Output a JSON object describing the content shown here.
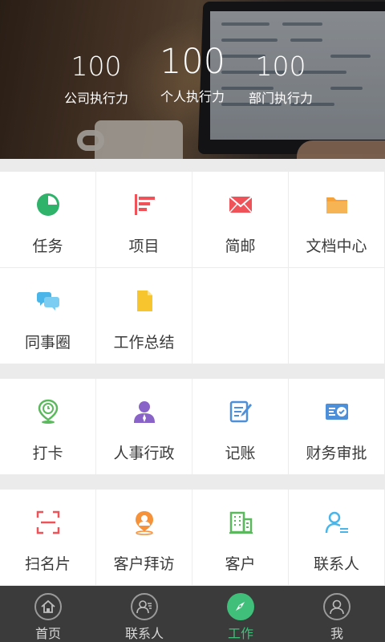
{
  "hero": {
    "stats": [
      {
        "value": "100",
        "label": "公司执行力"
      },
      {
        "value": "100",
        "label": "个人执行力"
      },
      {
        "value": "100",
        "label": "部门执行力"
      }
    ]
  },
  "sections": [
    {
      "items": [
        {
          "label": "任务",
          "icon": "pie-chart-icon",
          "color": "#2fb36b"
        },
        {
          "label": "项目",
          "icon": "project-bars-icon",
          "color": "#f0525a"
        },
        {
          "label": "简邮",
          "icon": "mail-icon",
          "color": "#f0525a"
        },
        {
          "label": "文档中心",
          "icon": "folder-icon",
          "color": "#f5a23a"
        },
        {
          "label": "同事圈",
          "icon": "chat-bubbles-icon",
          "color": "#49b5e8"
        },
        {
          "label": "工作总结",
          "icon": "document-icon",
          "color": "#f7c52e"
        }
      ]
    },
    {
      "items": [
        {
          "label": "打卡",
          "icon": "location-clock-icon",
          "color": "#5cb85c"
        },
        {
          "label": "人事行政",
          "icon": "person-icon",
          "color": "#8a63c9"
        },
        {
          "label": "记账",
          "icon": "edit-note-icon",
          "color": "#4d8fd9"
        },
        {
          "label": "财务审批",
          "icon": "approval-card-icon",
          "color": "#4d8fd9"
        }
      ]
    },
    {
      "items": [
        {
          "label": "扫名片",
          "icon": "scan-icon",
          "color": "#f0525a"
        },
        {
          "label": "客户拜访",
          "icon": "visit-pin-icon",
          "color": "#f5923a"
        },
        {
          "label": "客户",
          "icon": "building-icon",
          "color": "#5cb85c"
        },
        {
          "label": "联系人",
          "icon": "contact-icon",
          "color": "#49b5e8"
        }
      ]
    }
  ],
  "tabbar": {
    "tabs": [
      {
        "label": "首页",
        "icon": "home-icon"
      },
      {
        "label": "联系人",
        "icon": "contacts-icon"
      },
      {
        "label": "工作",
        "icon": "compass-icon",
        "active": true
      },
      {
        "label": "我",
        "icon": "user-icon"
      }
    ],
    "active_color": "#3fbf7a"
  }
}
